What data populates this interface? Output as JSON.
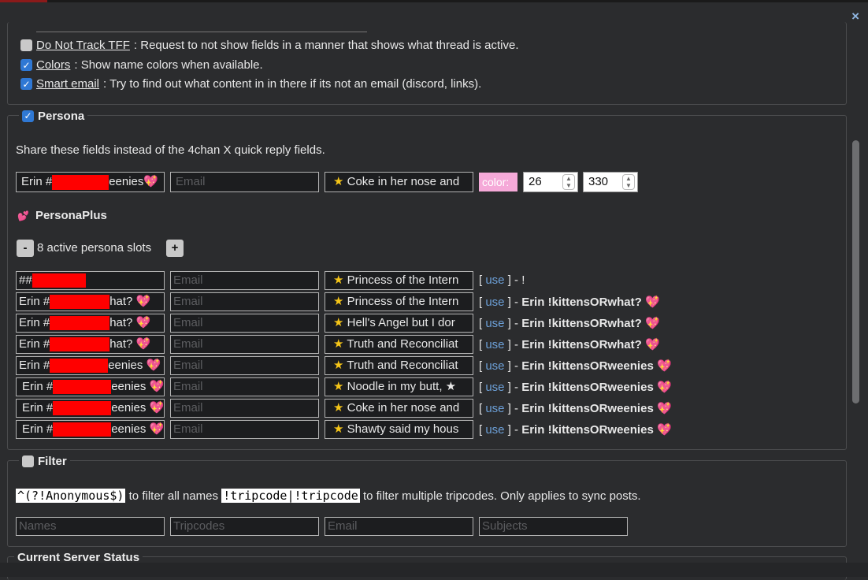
{
  "close_label": "×",
  "settings": {
    "do_not_track": {
      "label": "Do Not Track TFF",
      "desc": ": Request to not show fields in a manner that shows what thread is active.",
      "checked": false
    },
    "colors": {
      "label": "Colors",
      "desc": ": Show name colors when available.",
      "checked": true
    },
    "smart_email": {
      "label": "Smart email",
      "desc": ": Try to find out what content in in there if its not an email (discord, links).",
      "checked": true
    }
  },
  "persona": {
    "title": "Persona",
    "checked": true,
    "desc": "Share these fields instead of the 4chan X quick reply fields.",
    "name_prefix": "Erin #",
    "name_suffix": "eenies",
    "email_placeholder": "Email",
    "subject": "Coke in her nose and",
    "color_placeholder": "color:",
    "num1": "26",
    "num2": "330"
  },
  "personaplus": {
    "title": "PersonaPlus",
    "slots_label": "8 active persona slots",
    "minus_label": "-",
    "plus_label": "+",
    "use_label": "use",
    "slots": [
      {
        "name_prefix": "##",
        "name_suffix": "",
        "subject": "Princess of the Intern",
        "action_tail": " - !",
        "action_name": "",
        "action_trip": "",
        "heart": false
      },
      {
        "name_prefix": "Erin #",
        "name_suffix": "hat?",
        "subject": "Princess of the Intern",
        "action_tail": " - ",
        "action_name": "Erin",
        "action_trip": "!kittensORwhat?",
        "heart": true
      },
      {
        "name_prefix": "Erin #",
        "name_suffix": "hat?",
        "subject": "Hell's Angel but I dor",
        "action_tail": " - ",
        "action_name": "Erin",
        "action_trip": "!kittensORwhat?",
        "heart": true
      },
      {
        "name_prefix": "Erin #",
        "name_suffix": "hat?",
        "subject": "Truth and Reconciliat",
        "action_tail": " - ",
        "action_name": "Erin",
        "action_trip": "!kittensORwhat?",
        "heart": true
      },
      {
        "name_prefix": "Erin #",
        "name_suffix": "eenies",
        "subject": "Truth and Reconciliat",
        "action_tail": " - ",
        "action_name": "Erin",
        "action_trip": "!kittensORweenies",
        "heart": true
      },
      {
        "name_prefix": "Erin #",
        "name_suffix": "eenies",
        "subject": "Noodle in my butt, ★",
        "action_tail": " - ",
        "action_name": "Erin",
        "action_trip": "!kittensORweenies",
        "heart": true
      },
      {
        "name_prefix": "Erin #",
        "name_suffix": "eenies",
        "subject": "Coke in her nose and",
        "action_tail": " - ",
        "action_name": "Erin",
        "action_trip": "!kittensORweenies",
        "heart": true
      },
      {
        "name_prefix": "Erin #",
        "name_suffix": "eenies",
        "subject": "Shawty said my hous",
        "action_tail": " - ",
        "action_name": "Erin",
        "action_trip": "!kittensORweenies",
        "heart": true
      }
    ]
  },
  "filter": {
    "title": "Filter",
    "checked": false,
    "code1": "^(?!Anonymous$)",
    "text1": " to filter all names ",
    "code2": "!tripcode|!tripcode",
    "text2": " to filter multiple tripcodes. Only applies to sync posts.",
    "placeholders": {
      "names": "Names",
      "tripcodes": "Tripcodes",
      "email": "Email",
      "subjects": "Subjects"
    }
  },
  "server_status": {
    "title": "Current Server Status"
  },
  "colors": {
    "accent": "#2f78d4",
    "link": "#6c9fd6",
    "redact": "#ff0000",
    "heart": "#ff3fa2",
    "star": "#f5c518"
  },
  "icons": {
    "close": "close-icon",
    "star": "star-icon",
    "heart": "sparkle-heart-icon",
    "persona_plus": "two-hearts-icon"
  }
}
